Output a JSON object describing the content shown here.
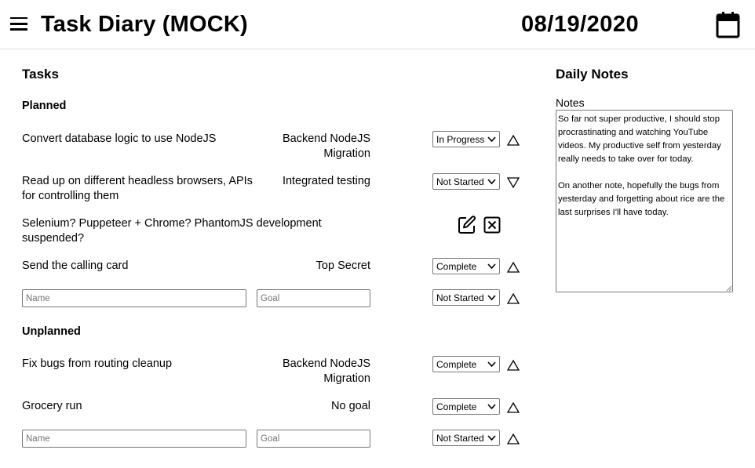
{
  "header": {
    "title": "Task Diary (MOCK)",
    "date": "08/19/2020",
    "menu_icon": "hamburger-menu-icon",
    "calendar_icon": "calendar-icon"
  },
  "tasks": {
    "heading": "Tasks",
    "planned": {
      "heading": "Planned",
      "items": [
        {
          "name": "Convert database logic to use NodeJS",
          "goal": "Backend NodeJS Migration",
          "status": "In Progress",
          "arrow": "up"
        },
        {
          "name": "Read up on different headless browsers, APIs for controlling them",
          "goal": "Integrated testing",
          "status": "Not Started",
          "arrow": "down"
        },
        {
          "name": "Selenium? Puppeteer + Chrome? PhantomJS development suspended?",
          "goal": "",
          "status": "",
          "arrow": ""
        },
        {
          "name": "Send the calling card",
          "goal": "Top Secret",
          "status": "Complete",
          "arrow": "up"
        }
      ],
      "new_row": {
        "name_placeholder": "Name",
        "goal_placeholder": "Goal",
        "status": "Not Started"
      }
    },
    "unplanned": {
      "heading": "Unplanned",
      "items": [
        {
          "name": "Fix bugs from routing cleanup",
          "goal": "Backend NodeJS Migration",
          "status": "Complete",
          "arrow": "up"
        },
        {
          "name": "Grocery run",
          "goal": "No goal",
          "status": "Complete",
          "arrow": "up"
        }
      ],
      "new_row": {
        "name_placeholder": "Name",
        "goal_placeholder": "Goal",
        "status": "Not Started"
      }
    }
  },
  "daily_notes": {
    "heading": "Daily Notes",
    "label": "Notes",
    "text": "So far not super productive, I should stop procrastinating and watching YouTube videos. My productive self from yesterday really needs to take over for today.\n\nOn another note, hopefully the bugs from yesterday and forgetting about rice are the last surprises I'll have today."
  }
}
